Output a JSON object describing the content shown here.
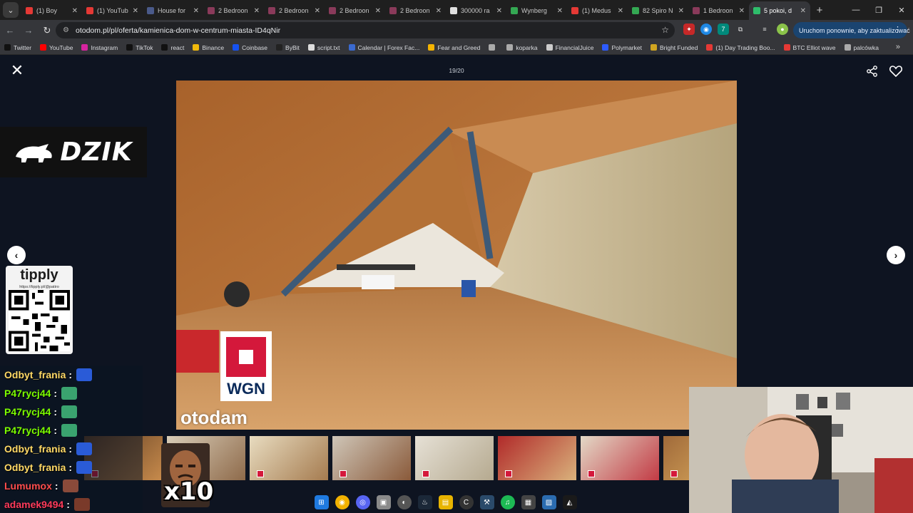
{
  "browser": {
    "tabs": [
      {
        "title": "(1) Boy",
        "color": "#e53935"
      },
      {
        "title": "(1) YouTub",
        "color": "#e53935"
      },
      {
        "title": "House for",
        "color": "#4a5a8a"
      },
      {
        "title": "2 Bedroon",
        "color": "#8a3a5a"
      },
      {
        "title": "2 Bedroon",
        "color": "#8a3a5a"
      },
      {
        "title": "2 Bedroon",
        "color": "#8a3a5a"
      },
      {
        "title": "2 Bedroon",
        "color": "#8a3a5a"
      },
      {
        "title": "300000 ra",
        "color": "#e0e0e0"
      },
      {
        "title": "Wynberg",
        "color": "#34a853"
      },
      {
        "title": "(1) Medus",
        "color": "#e53935"
      },
      {
        "title": "82 Spiro N",
        "color": "#34a853"
      },
      {
        "title": "1 Bedroon",
        "color": "#8a3a5a"
      },
      {
        "title": "5 pokoi, d",
        "color": "#2ebd6b"
      }
    ],
    "url": "otodom.pl/pl/oferta/kamienica-dom-w-centrum-miasta-ID4qNir",
    "update_button": "Uruchom ponownie, aby zaktualizować",
    "bookmarks": [
      {
        "label": "Twitter",
        "color": "#111111"
      },
      {
        "label": "YouTube",
        "color": "#ff0000"
      },
      {
        "label": "Instagram",
        "color": "#d6249f"
      },
      {
        "label": "TikTok",
        "color": "#111111"
      },
      {
        "label": "react",
        "color": "#111111"
      },
      {
        "label": "Binance",
        "color": "#f0b90b"
      },
      {
        "label": "Coinbase",
        "color": "#1652f0"
      },
      {
        "label": "ByBit",
        "color": "#222222"
      },
      {
        "label": "script.txt",
        "color": "#dddddd"
      },
      {
        "label": "Calendar | Forex Fac...",
        "color": "#3a6ad0"
      },
      {
        "label": "Fear and Greed",
        "color": "#f4b400"
      },
      {
        "label": "",
        "color": "#aaaaaa"
      },
      {
        "label": "koparka",
        "color": "#aaaaaa"
      },
      {
        "label": "FinancialJuice",
        "color": "#cccccc"
      },
      {
        "label": "Polymarket",
        "color": "#2d5bff"
      },
      {
        "label": "Bright Funded",
        "color": "#d0a520"
      },
      {
        "label": "(1) Day Trading Boo...",
        "color": "#e53935"
      },
      {
        "label": "BTC Elliot wave",
        "color": "#e53935"
      },
      {
        "label": "palcówka",
        "color": "#aaaaaa"
      }
    ]
  },
  "gallery": {
    "counter": "19/20",
    "watermark": {
      "logo": "WGN",
      "brand": "otodam"
    }
  },
  "overlay": {
    "dzik_logo": "DZIK",
    "tipply": {
      "title": "tipply",
      "url": "https://tipply.pl/@patiro"
    },
    "chat": [
      {
        "user": "Odbyt_frania",
        "sep": ":",
        "color": "#ffd966"
      },
      {
        "user": "P47rycj44",
        "sep": ":",
        "color": "#7cfc00"
      },
      {
        "user": "P47rycj44",
        "sep": ":",
        "color": "#7cfc00"
      },
      {
        "user": "P47rycj44",
        "sep": ":",
        "color": "#7cfc00"
      },
      {
        "user": "Odbyt_frania",
        "sep": ":",
        "color": "#ffd966"
      },
      {
        "user": "Odbyt_frania",
        "sep": ":",
        "color": "#ffd966"
      },
      {
        "user": "Lumumox",
        "sep": ":",
        "color": "#ff4d4d"
      },
      {
        "user": "adamek9494",
        "sep": ":",
        "color": "#ff3b5c"
      }
    ],
    "multiplier": "x10"
  }
}
